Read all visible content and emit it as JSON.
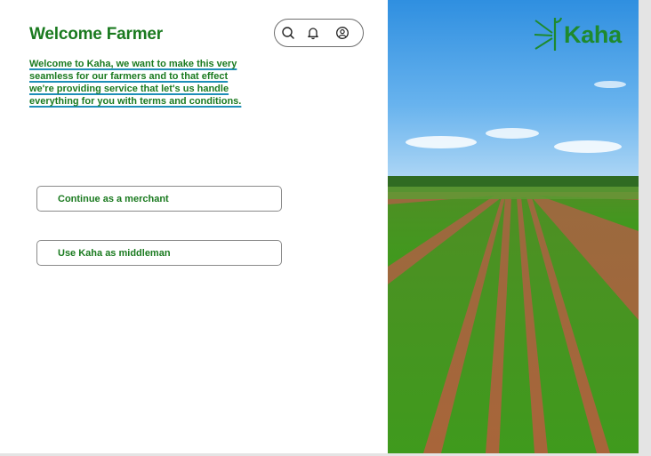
{
  "header": {
    "title": "Welcome Farmer",
    "intro_lines": [
      "Welcome to  Kaha, we want to make this very",
      "seamless for our farmers and to that effect",
      "we're providing service that let's us handle",
      "everything for you with terms and conditions."
    ]
  },
  "toolbar": {
    "icons": [
      "search-icon",
      "bell-icon",
      "user-circle-icon"
    ]
  },
  "actions": {
    "merchant_label": "Continue as a merchant",
    "middleman_label": "Use Kaha as middleman"
  },
  "brand": {
    "logo_text": "Kaha",
    "color": "#1e8a2e"
  },
  "colors": {
    "accent_green": "#1a7a1f",
    "underline_blue": "#1f8fb8"
  }
}
